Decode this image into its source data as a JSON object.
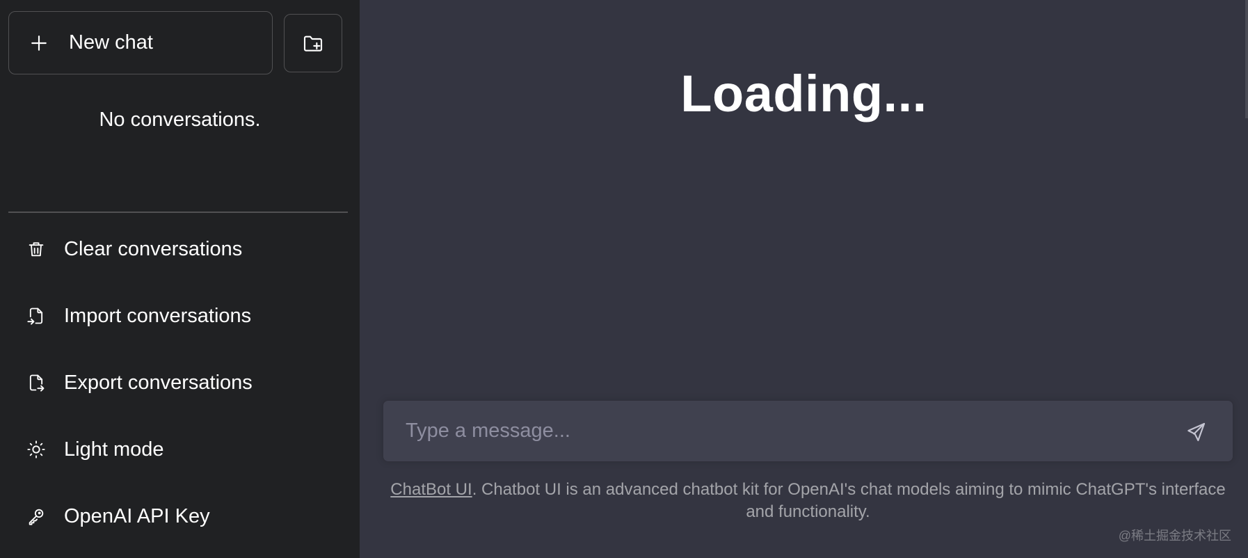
{
  "sidebar": {
    "new_chat_label": "New chat",
    "empty_state": "No conversations.",
    "items": [
      {
        "label": "Clear conversations",
        "icon": "trash-icon"
      },
      {
        "label": "Import conversations",
        "icon": "file-import-icon"
      },
      {
        "label": "Export conversations",
        "icon": "file-export-icon"
      },
      {
        "label": "Light mode",
        "icon": "sun-icon"
      },
      {
        "label": "OpenAI API Key",
        "icon": "key-icon"
      }
    ]
  },
  "main": {
    "title": "Loading...",
    "composer": {
      "placeholder": "Type a message..."
    },
    "footer": {
      "link_text": "ChatBot UI",
      "text": ". Chatbot UI is an advanced chatbot kit for OpenAI's chat models aiming to mimic ChatGPT's interface and functionality."
    },
    "watermark": "@稀土掘金技术社区"
  },
  "colors": {
    "sidebar_bg": "#202123",
    "main_bg": "#343541",
    "composer_bg": "#40414f",
    "text": "#ececf1"
  }
}
